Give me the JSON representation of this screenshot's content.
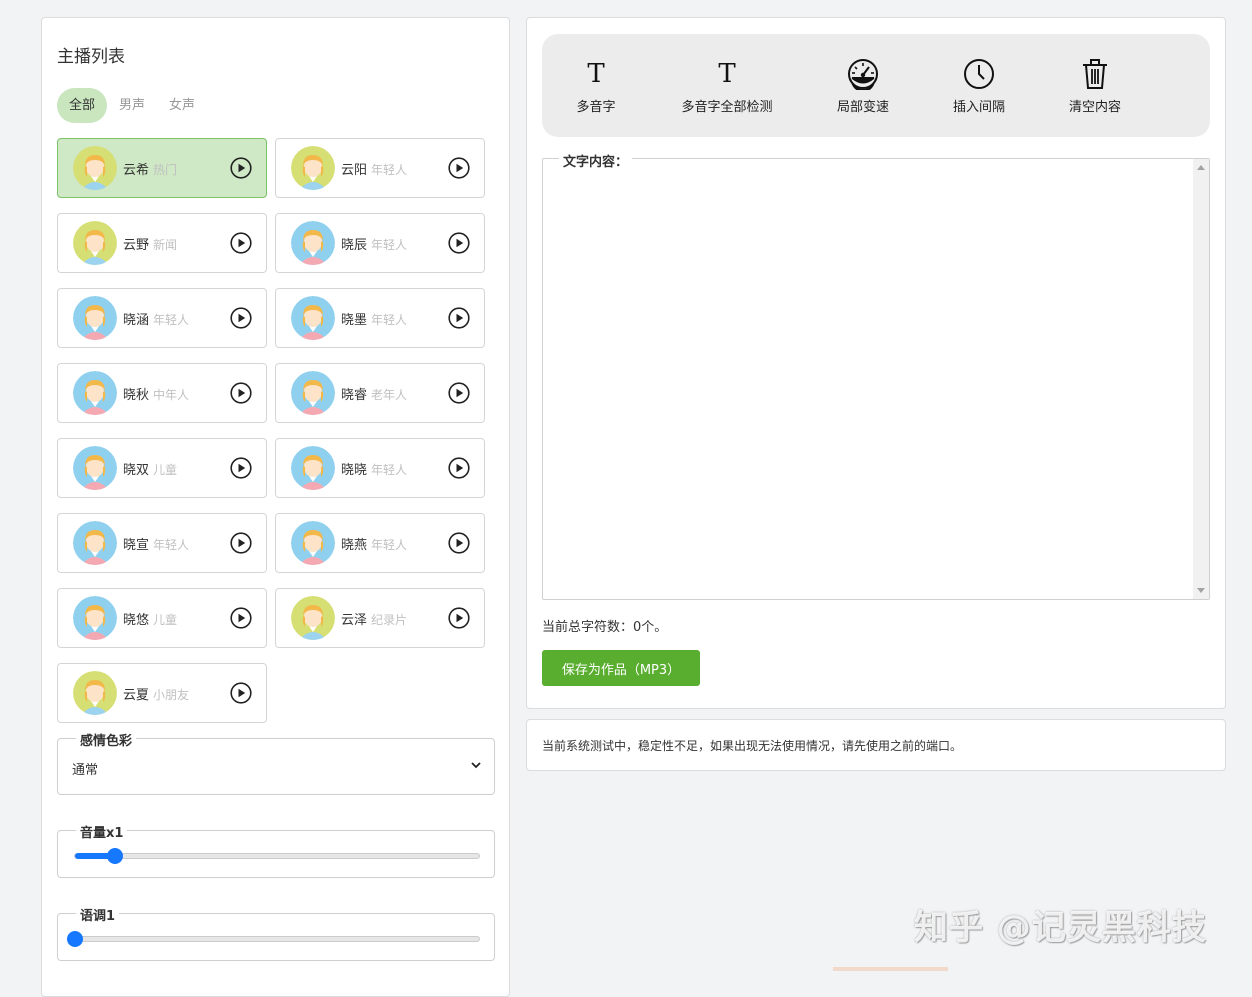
{
  "left": {
    "title": "主播列表",
    "filters": [
      "全部",
      "男声",
      "女声"
    ],
    "anchors": [
      {
        "name": "云希",
        "tag": "热门",
        "selected": true,
        "avatar": "male"
      },
      {
        "name": "云阳",
        "tag": "年轻人",
        "selected": false,
        "avatar": "male"
      },
      {
        "name": "云野",
        "tag": "新闻",
        "selected": false,
        "avatar": "male"
      },
      {
        "name": "晓辰",
        "tag": "年轻人",
        "selected": false,
        "avatar": "female"
      },
      {
        "name": "晓涵",
        "tag": "年轻人",
        "selected": false,
        "avatar": "female"
      },
      {
        "name": "晓墨",
        "tag": "年轻人",
        "selected": false,
        "avatar": "female"
      },
      {
        "name": "晓秋",
        "tag": "中年人",
        "selected": false,
        "avatar": "female"
      },
      {
        "name": "晓睿",
        "tag": "老年人",
        "selected": false,
        "avatar": "female"
      },
      {
        "name": "晓双",
        "tag": "儿童",
        "selected": false,
        "avatar": "female"
      },
      {
        "name": "晓晓",
        "tag": "年轻人",
        "selected": false,
        "avatar": "female"
      },
      {
        "name": "晓宣",
        "tag": "年轻人",
        "selected": false,
        "avatar": "female"
      },
      {
        "name": "晓燕",
        "tag": "年轻人",
        "selected": false,
        "avatar": "female"
      },
      {
        "name": "晓悠",
        "tag": "儿童",
        "selected": false,
        "avatar": "female"
      },
      {
        "name": "云泽",
        "tag": "纪录片",
        "selected": false,
        "avatar": "male"
      },
      {
        "name": "云夏",
        "tag": "小朋友",
        "selected": false,
        "avatar": "male"
      }
    ],
    "emotion": {
      "label": "感情色彩",
      "value": "通常"
    },
    "volume": {
      "label": "音量x1",
      "level": 0.1
    },
    "pitch": {
      "label": "语调1",
      "level": 0.0
    }
  },
  "toolbar": {
    "items": [
      {
        "label": "多音字",
        "icon": "text-t-icon"
      },
      {
        "label": "多音字全部检测",
        "icon": "text-t-icon"
      },
      {
        "label": "局部变速",
        "icon": "speedometer-icon"
      },
      {
        "label": "插入间隔",
        "icon": "clock-icon"
      },
      {
        "label": "清空内容",
        "icon": "trash-icon"
      }
    ]
  },
  "editor": {
    "legend": "文字内容：",
    "value": "",
    "char_count": "当前总字符数：0个。",
    "save_label": "保存为作品（MP3）"
  },
  "notice": "当前系统测试中，稳定性不足，如果出现无法使用情况，请先使用之前的端口。",
  "watermark": "知乎 @记灵黑科技",
  "colors": {
    "accent_green": "#5aae2f",
    "selected_card": "#cfe8c5",
    "slider_blue": "#1677ff"
  }
}
